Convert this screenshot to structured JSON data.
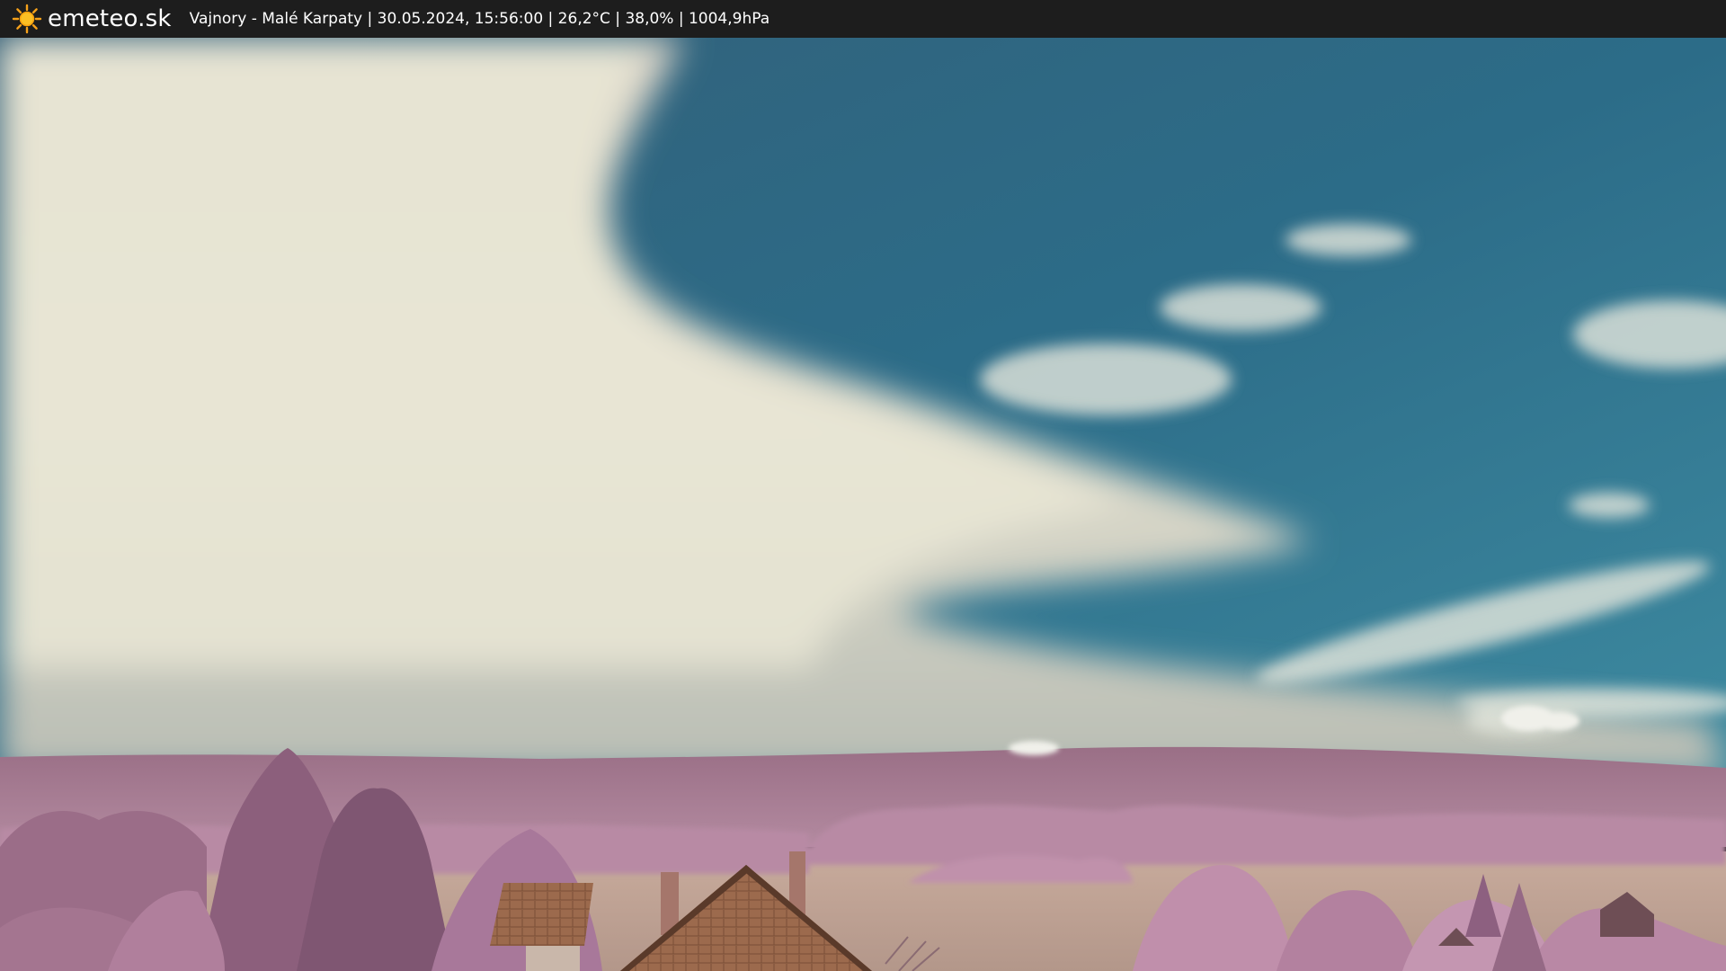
{
  "header": {
    "brand": "emeteo.sk",
    "info": "Vajnory - Malé Karpaty | 30.05.2024, 15:56:00 | 26,2°C | 38,0% | 1004,9hPa",
    "logo_icon": "sun-icon"
  },
  "colors": {
    "topbar": "#1d1d1d",
    "sky_blue": "#2f6f8a",
    "cloud": "#e6e3d2",
    "foliage": "#b07a96",
    "field": "#c3a596",
    "roof": "#9a6a4e"
  }
}
